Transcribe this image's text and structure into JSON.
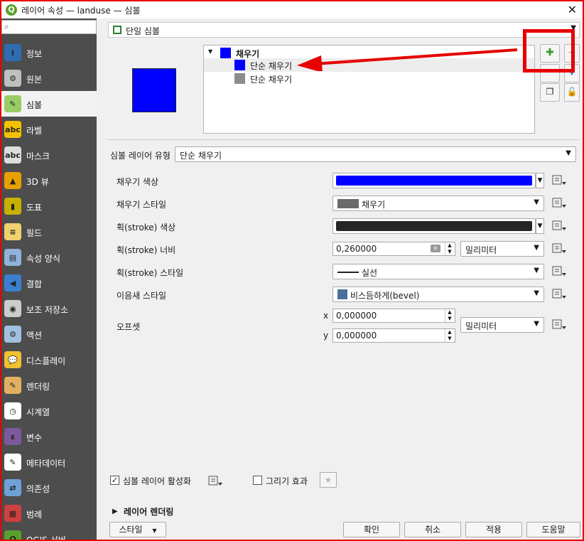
{
  "window": {
    "title": "레이어 속성 — landuse — 심볼"
  },
  "sidebar": {
    "search_placeholder": "",
    "items": [
      {
        "label": "정보",
        "icon": "info-icon",
        "color": "#2f6db3",
        "glyph": "i"
      },
      {
        "label": "원본",
        "icon": "source-icon",
        "color": "#bfbfbf",
        "glyph": "⚙"
      },
      {
        "label": "심볼",
        "icon": "paintbrush-icon",
        "color": "#9c6",
        "glyph": "✎"
      },
      {
        "label": "라벨",
        "icon": "abc-label-icon",
        "color": "#f2c200",
        "glyph": "abc"
      },
      {
        "label": "마스크",
        "icon": "abc-mask-icon",
        "color": "#dddddd",
        "glyph": "abc"
      },
      {
        "label": "3D 뷰",
        "icon": "cube-3d-icon",
        "color": "#e8a000",
        "glyph": "▲"
      },
      {
        "label": "도표",
        "icon": "diagram-icon",
        "color": "#c8b000",
        "glyph": "▮"
      },
      {
        "label": "필드",
        "icon": "fields-icon",
        "color": "#f0d070",
        "glyph": "≡"
      },
      {
        "label": "속성 양식",
        "icon": "form-icon",
        "color": "#8fb3d9",
        "glyph": "▤"
      },
      {
        "label": "결합",
        "icon": "join-icon",
        "color": "#3a7fd0",
        "glyph": "◀"
      },
      {
        "label": "보조 저장소",
        "icon": "database-icon",
        "color": "#cccccc",
        "glyph": "◉"
      },
      {
        "label": "액션",
        "icon": "action-gear-icon",
        "color": "#a0c0e0",
        "glyph": "⚙"
      },
      {
        "label": "디스플레이",
        "icon": "speech-bubble-icon",
        "color": "#f0c030",
        "glyph": "💬"
      },
      {
        "label": "렌더링",
        "icon": "rendering-brush-icon",
        "color": "#e0b060",
        "glyph": "✎"
      },
      {
        "label": "시계열",
        "icon": "clock-icon",
        "color": "#ffffff",
        "glyph": "◷"
      },
      {
        "label": "변수",
        "icon": "variable-epsilon-icon",
        "color": "#7a5a9a",
        "glyph": "ε"
      },
      {
        "label": "메타데이터",
        "icon": "metadata-icon",
        "color": "#ffffff",
        "glyph": "✎"
      },
      {
        "label": "의존성",
        "icon": "dependency-icon",
        "color": "#6fa0d8",
        "glyph": "⇄"
      },
      {
        "label": "범례",
        "icon": "legend-icon",
        "color": "#d04040",
        "glyph": "▦"
      },
      {
        "label": "QGIS 서버",
        "icon": "qgis-server-icon",
        "color": "#5aa02c",
        "glyph": "Q"
      }
    ],
    "active_index": 2
  },
  "renderer": {
    "label": "단일 심볼"
  },
  "symbol_tree": {
    "root": {
      "label": "채우기",
      "color": "#0000ff"
    },
    "layers": [
      {
        "label": "단순 채우기",
        "color": "#0000ff",
        "selected": true
      },
      {
        "label": "단순 채우기",
        "color": "#8c8c8c",
        "selected": false
      }
    ]
  },
  "symbol_layer_type": {
    "label": "심볼 레이어 유형",
    "value": "단순 채우기"
  },
  "props": {
    "fill_color_label": "채우기 색상",
    "fill_color": "#0000ff",
    "fill_style_label": "채우기 스타일",
    "fill_style_value": "채우기",
    "stroke_color_label": "획(stroke) 색상",
    "stroke_color": "#262626",
    "stroke_width_label": "획(stroke) 너비",
    "stroke_width_value": "0,260000",
    "stroke_width_unit": "밀리미터",
    "stroke_style_label": "획(stroke) 스타일",
    "stroke_style_value": "실선",
    "join_style_label": "이음새 스타일",
    "join_style_value": "비스듬하게(bevel)",
    "offset_label": "오프셋",
    "offset_x_label": "x",
    "offset_x": "0,000000",
    "offset_y_label": "y",
    "offset_y": "0,000000",
    "offset_unit": "밀리미터"
  },
  "footer": {
    "enable_layer_label": "심볼 레이어 활성화",
    "draw_effects_label": "그리기 효과",
    "layer_rendering_label": "레이어 렌더링",
    "style_button": "스타일",
    "ok": "확인",
    "cancel": "취소",
    "apply": "적용",
    "help": "도움말"
  }
}
